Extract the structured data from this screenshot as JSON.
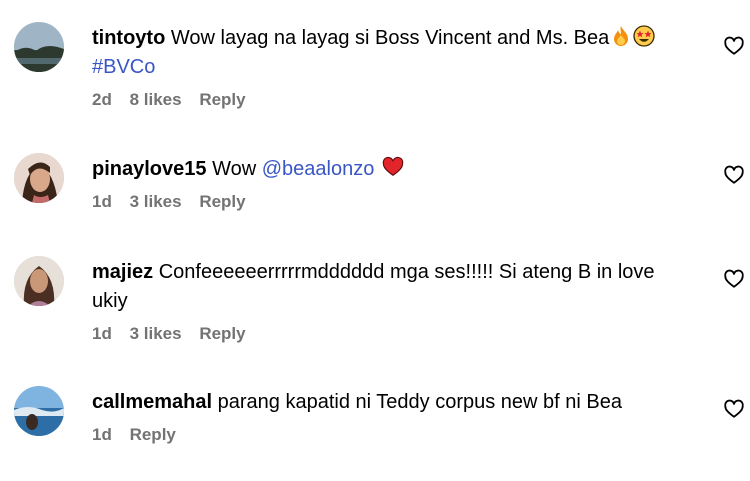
{
  "comments": [
    {
      "username": "tintoyto",
      "text": "Wow layag na layag si Boss Vincent and Ms. Bea",
      "emoji1": "fire-emoji",
      "emoji2": "star-struck-emoji",
      "hashtag": "#BVCo",
      "time": "2d",
      "likes": "8 likes",
      "reply": "Reply"
    },
    {
      "username": "pinaylove15",
      "text": "Wow",
      "mention": "@beaalonzo",
      "emoji1": "red-heart-emoji",
      "time": "1d",
      "likes": "3 likes",
      "reply": "Reply"
    },
    {
      "username": "majiez",
      "text": "Confeeeeeerrrrrmdddddd mga ses!!!!! Si ateng B in love ukiy",
      "time": "1d",
      "likes": "3 likes",
      "reply": "Reply"
    },
    {
      "username": "callmemahal",
      "text": "parang kapatid ni Teddy corpus new bf ni Bea",
      "time": "1d",
      "reply": "Reply"
    }
  ],
  "colors": {
    "link": "#3a56c5",
    "meta": "#737373",
    "heart_emoji": "#e3242b"
  },
  "icons": {
    "like": "heart-outline-icon"
  }
}
